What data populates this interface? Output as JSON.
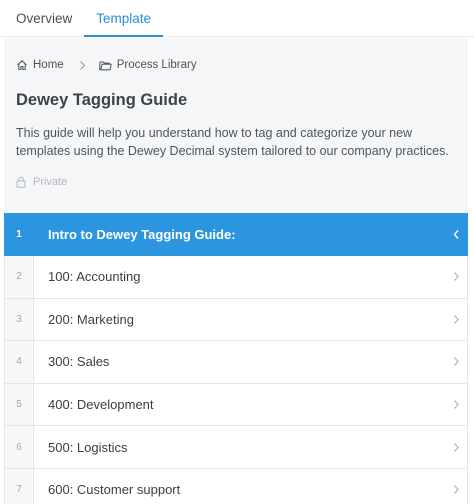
{
  "tabs": [
    {
      "label": "Overview",
      "active": false
    },
    {
      "label": "Template",
      "active": true
    }
  ],
  "breadcrumb": {
    "home": {
      "label": "Home",
      "icon": "home-icon"
    },
    "separator_icon": "chevron-right-icon",
    "folder": {
      "label": "Process Library",
      "icon": "folder-icon"
    }
  },
  "template": {
    "title": "Dewey Tagging Guide",
    "description": "This guide will help you understand how to tag and categorize your new templates using the Dewey Decimal system tailored to our company practices.",
    "privacy": {
      "label": "Private",
      "icon": "lock-icon"
    }
  },
  "steps": [
    {
      "number": "1",
      "label": "Intro to Dewey Tagging Guide:",
      "active": true,
      "chevron": "chevron-left-icon"
    },
    {
      "number": "2",
      "label": "100: Accounting",
      "active": false,
      "chevron": "chevron-right-icon"
    },
    {
      "number": "3",
      "label": "200: Marketing",
      "active": false,
      "chevron": "chevron-right-icon"
    },
    {
      "number": "4",
      "label": "300: Sales",
      "active": false,
      "chevron": "chevron-right-icon"
    },
    {
      "number": "5",
      "label": "400: Development",
      "active": false,
      "chevron": "chevron-right-icon"
    },
    {
      "number": "6",
      "label": "500: Logistics",
      "active": false,
      "chevron": "chevron-right-icon"
    },
    {
      "number": "7",
      "label": "600: Customer support",
      "active": false,
      "chevron": "chevron-right-icon"
    }
  ],
  "colors": {
    "accent": "#2b95e0",
    "tab_active": "#2b8fd6",
    "header_bg": "#f5f6f7"
  }
}
